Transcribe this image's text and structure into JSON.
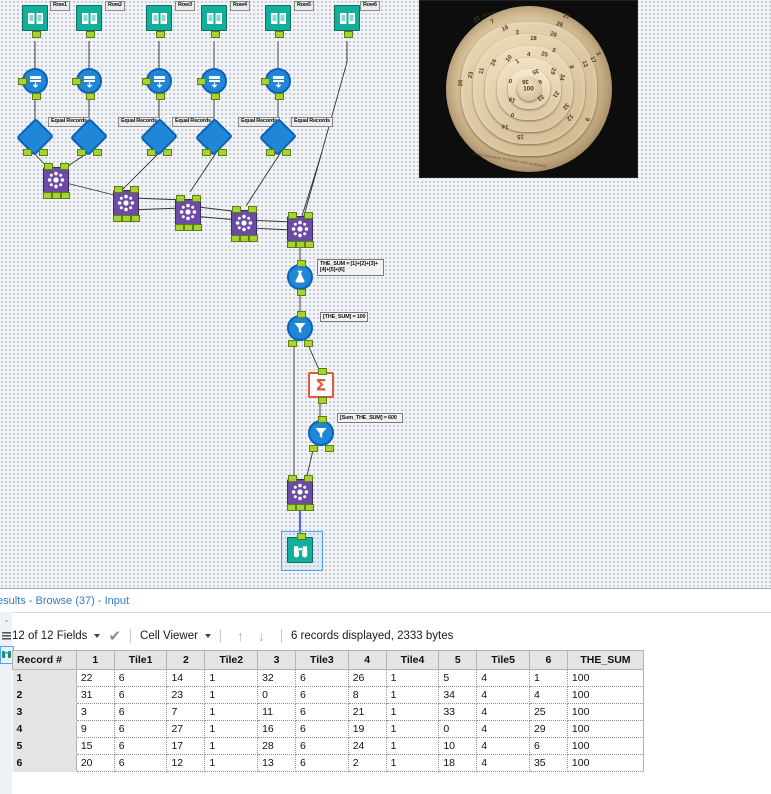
{
  "window": {
    "results_tab_title": "esults - Browse (37) - Input"
  },
  "canvas": {
    "input_labels": [
      "Row1",
      "Row2",
      "Row3",
      "Row4",
      "Row5",
      "Row6"
    ],
    "equal_records_labels": [
      "Equal Records",
      "Equal Records",
      "Equal Records",
      "Equal Records",
      "Equal Records"
    ],
    "annotations": [
      {
        "id": "formula",
        "text": "THE_SUM = [1]+[2]+[3]+[4]+[5]+[6]"
      },
      {
        "id": "filter-1",
        "text": "[THE_SUM] = 100"
      },
      {
        "id": "filter-2",
        "text": "[Sum_THE_SUM] = 600"
      }
    ],
    "tool_names": {
      "input": "input-data-tool",
      "select": "select-tool",
      "sample": "random-sample-tool",
      "join": "join-tool",
      "formula": "formula-tool",
      "filter": "filter-tool",
      "summarize": "summarize-tool",
      "browse": "browse-tool"
    },
    "colors": {
      "input_teal": "#12b09c",
      "blue": "#1f86d8",
      "join_purple": "#6b4ba3",
      "summarize_orange": "#e2593a",
      "port_green": "#a4d430",
      "selection_blue": "#4da3ff"
    },
    "photo": {
      "caption_top": "REVOLV",
      "caption_bottom": "ALIGN COLUMNS TO EQUAL ONE HUNDRED",
      "hub_value": "100",
      "ring_numbers": [
        "22",
        "7",
        "18",
        "2",
        "27",
        "28",
        "26",
        "18",
        "4",
        "25",
        "5",
        "3",
        "17",
        "13",
        "8",
        "29",
        "34",
        "24",
        "10",
        "1",
        "36",
        "6",
        "33",
        "21",
        "11",
        "23",
        "0",
        "19",
        "32",
        "12",
        "20",
        "9",
        "14",
        "0",
        "15",
        "35"
      ]
    }
  },
  "results": {
    "fields_selector": "12 of 12 Fields",
    "viewer_selector": "Cell Viewer",
    "record_status": "6 records displayed, 2333 bytes",
    "columns": [
      "Record #",
      "1",
      "Tile1",
      "2",
      "Tile2",
      "3",
      "Tile3",
      "4",
      "Tile4",
      "5",
      "Tile5",
      "6",
      "THE_SUM"
    ],
    "rows": [
      {
        "record": "1",
        "cells": [
          "22",
          "6",
          "14",
          "1",
          "32",
          "6",
          "26",
          "1",
          "5",
          "4",
          "1",
          "100"
        ]
      },
      {
        "record": "2",
        "cells": [
          "31",
          "6",
          "23",
          "1",
          "0",
          "6",
          "8",
          "1",
          "34",
          "4",
          "4",
          "100"
        ]
      },
      {
        "record": "3",
        "cells": [
          "3",
          "6",
          "7",
          "1",
          "11",
          "6",
          "21",
          "1",
          "33",
          "4",
          "25",
          "100"
        ]
      },
      {
        "record": "4",
        "cells": [
          "9",
          "6",
          "27",
          "1",
          "16",
          "6",
          "19",
          "1",
          "0",
          "4",
          "29",
          "100"
        ]
      },
      {
        "record": "5",
        "cells": [
          "15",
          "6",
          "17",
          "1",
          "28",
          "6",
          "24",
          "1",
          "10",
          "4",
          "6",
          "100"
        ]
      },
      {
        "record": "6",
        "cells": [
          "20",
          "6",
          "12",
          "1",
          "13",
          "6",
          "2",
          "1",
          "18",
          "4",
          "35",
          "100"
        ]
      }
    ]
  }
}
